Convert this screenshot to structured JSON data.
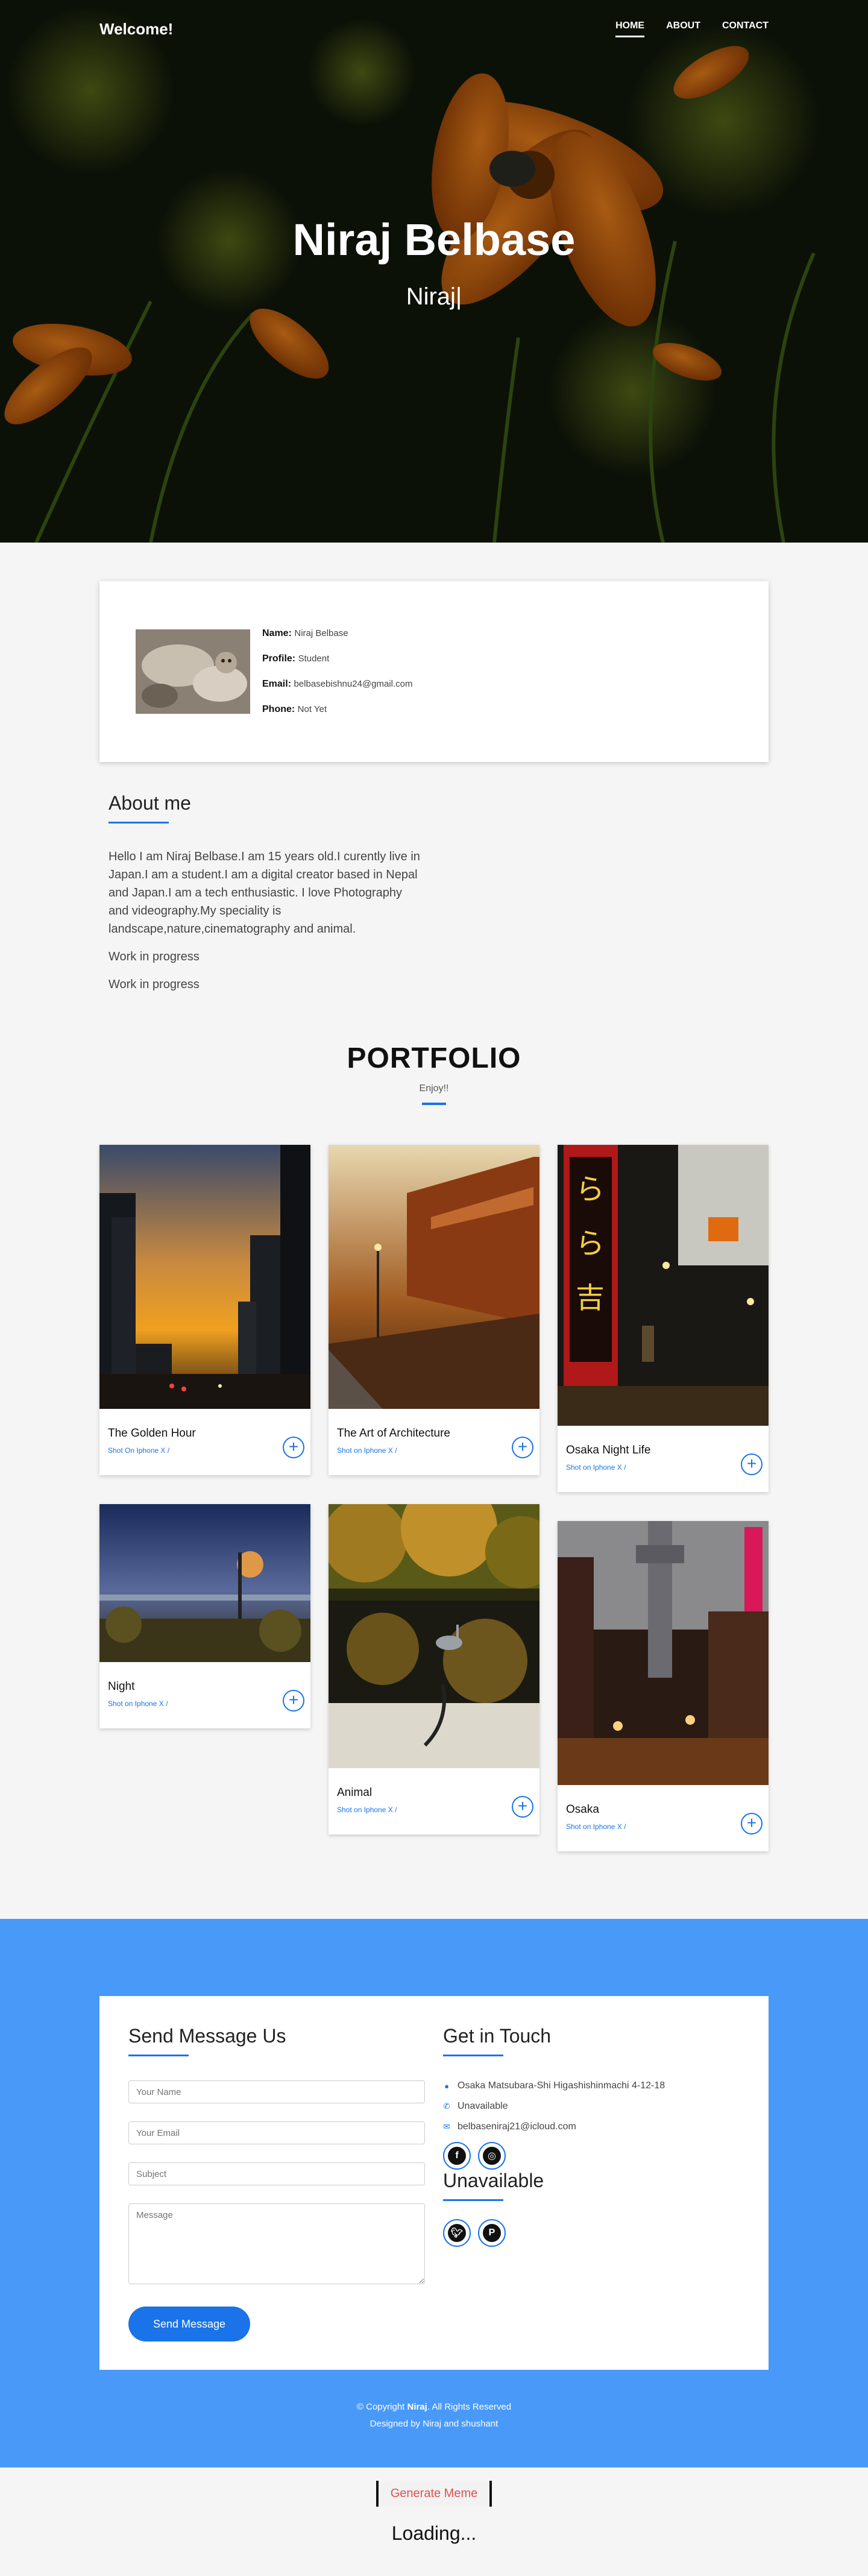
{
  "nav": {
    "brand": "Welcome!",
    "links": [
      "HOME",
      "ABOUT",
      "CONTACT"
    ]
  },
  "hero": {
    "title": "Niraj Belbase",
    "subtitle": "Niraj|"
  },
  "profile": {
    "name_label": "Name:",
    "name": "Niraj Belbase",
    "profile_label": "Profile:",
    "profile": "Student",
    "email_label": "Email:",
    "email": "belbasebishnu24@gmail.com",
    "phone_label": "Phone:",
    "phone": "Not Yet"
  },
  "about": {
    "heading": "About me",
    "paragraphs": [
      "Hello I am Niraj Belbase.I am 15 years old.I curently live in Japan.I am a student.I am a digital creator based in Nepal and Japan.I am a tech enthusiastic. I love Photography and videography.My speciality is landscape,nature,cinematography and animal.",
      "Work in progress",
      "Work in progress"
    ]
  },
  "portfolio": {
    "heading": "PORTFOLIO",
    "sub": "Enjoy!!",
    "items": [
      {
        "title": "The Golden Hour",
        "caption": "Shot On Iphone X /"
      },
      {
        "title": "The Art of Architecture",
        "caption": "Shot on Iphone X /"
      },
      {
        "title": "Osaka Night Life",
        "caption": "Shot on Iphone X /"
      },
      {
        "title": "Night",
        "caption": "Shot on Iphone X /"
      },
      {
        "title": "Animal",
        "caption": "Shot on Iphone X /"
      },
      {
        "title": "Osaka",
        "caption": "Shot on Iphone X /"
      }
    ]
  },
  "contact": {
    "form_heading": "Send Message Us",
    "name_placeholder": "Your Name",
    "email_placeholder": "Your Email",
    "subject_placeholder": "Subject",
    "message_placeholder": "Message",
    "send_label": "Send Message",
    "touch_heading": "Get in Touch",
    "address": "Osaka Matsubara-Shi Higashishinmachi 4-12-18",
    "phone": "Unavailable",
    "email": "belbaseniraj21@icloud.com",
    "social_heading": "Unavailable",
    "social_icons": [
      "facebook-icon",
      "instagram-icon",
      "twitter-icon",
      "pinterest-icon"
    ]
  },
  "footer": {
    "copy_prefix": "© Copyright ",
    "copy_name": "Niraj",
    "copy_suffix": ". All Rights Reserved",
    "designed": "Designed by Niraj and shushant"
  },
  "meme": {
    "button": "Generate Meme",
    "loading": "Loading..."
  },
  "colors": {
    "accent": "#1a73e8",
    "contact_bg": "#4999f8",
    "meme_text": "#e05050"
  }
}
